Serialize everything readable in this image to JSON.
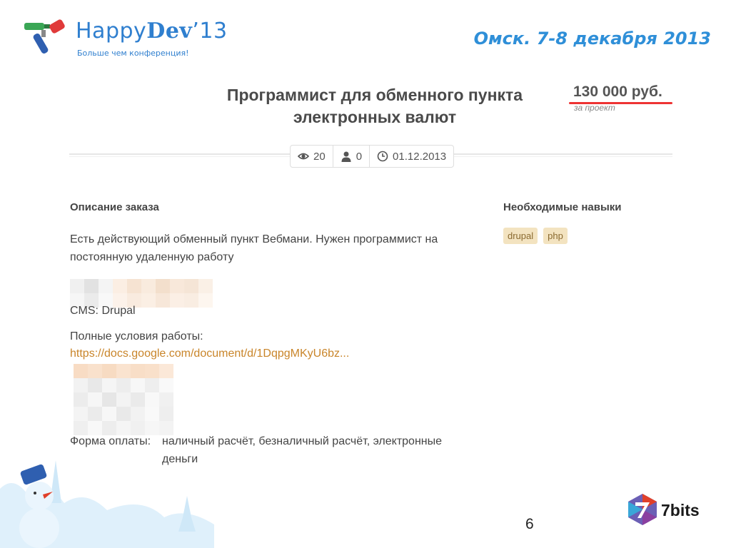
{
  "header": {
    "brand_light": "Happy",
    "brand_bold": "Dev",
    "brand_year": "’13",
    "tagline": "Больше чем конференция!",
    "event": "Омск. 7-8 декабря 2013"
  },
  "job": {
    "title": "Программист для обменного пункта электронных валют",
    "price": "130 000 руб.",
    "price_note": "за проект",
    "stats": {
      "views": "20",
      "responses": "0",
      "date": "01.12.2013"
    }
  },
  "description": {
    "title": "Описание заказа",
    "text": "Есть действующий обменный пункт Вебмани. Нужен программист на постоянную удаленную работу",
    "cms": "CMS: Drupal",
    "terms_label": "Полные условия работы:",
    "terms_link": "https://docs.google.com/document/d/1DqpgMKyU6bz...",
    "payment_label": "Форма оплаты:",
    "payment_value": "наличный расчёт, безналичный расчёт, электронные деньги"
  },
  "skills": {
    "title": "Необходимые навыки",
    "tags": [
      "drupal",
      "php"
    ]
  },
  "footer": {
    "page_number": "6",
    "sponsor": "7bits"
  },
  "colors": {
    "brand_blue": "#2f7fcf",
    "price_underline": "#e33333",
    "link": "#c9852a",
    "tag_bg": "#f3e3c0"
  },
  "icons": [
    "happydev-logo-icon",
    "eye-icon",
    "user-icon",
    "clock-icon",
    "snowman-decoration",
    "7bits-logo-icon"
  ]
}
